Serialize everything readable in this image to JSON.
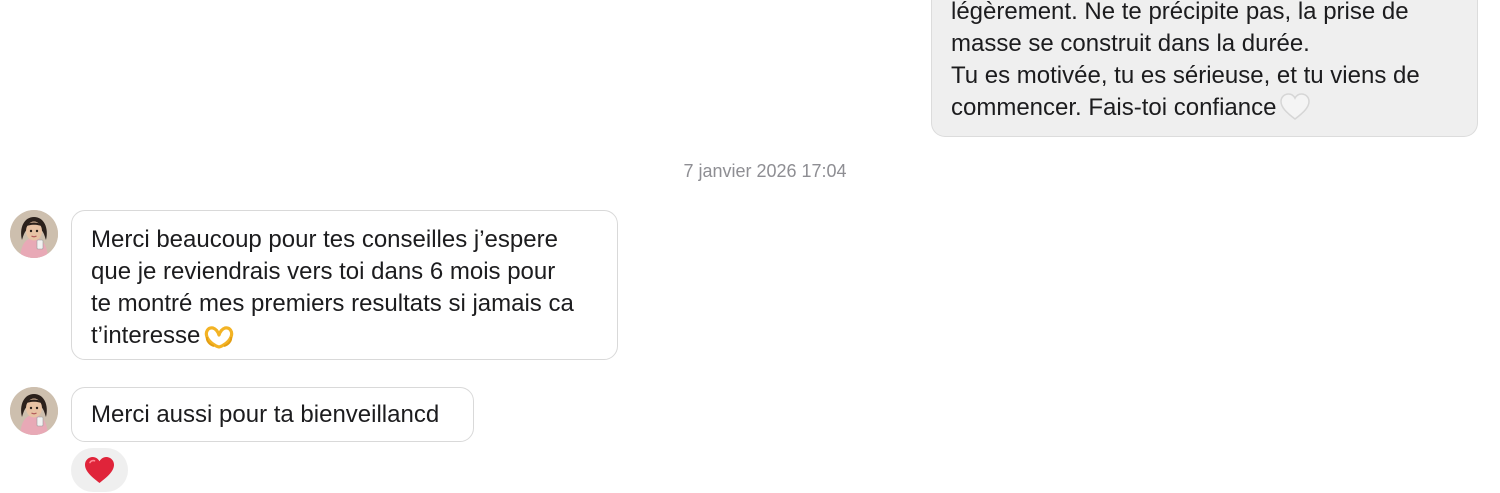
{
  "messages": {
    "outgoing": {
      "lines": [
        "légèrement. Ne te précipite pas, la prise de",
        "masse se construit dans la durée.",
        "Tu es motivée, tu es sérieuse, et tu viens de",
        "commencer. Fais-toi confiance"
      ],
      "trailing_emoji": "white-heart"
    },
    "timestamp": "7 janvier 2026 17:04",
    "incoming": [
      {
        "lines": [
          "Merci beaucoup pour tes conseilles j’espere",
          "que je reviendrais vers toi dans 6 mois pour",
          "te montré mes premiers resultats si jamais ca",
          "t’interesse"
        ],
        "trailing_emoji": "heart-hands"
      },
      {
        "lines": [
          "Merci aussi pour ta bienveillancd"
        ],
        "reaction": "red-heart"
      }
    ]
  },
  "colors": {
    "incoming_border": "#d9d9d9",
    "outgoing_bg": "#efefef",
    "timestamp": "#8e8e93",
    "reaction_heart": "#e0243a"
  }
}
